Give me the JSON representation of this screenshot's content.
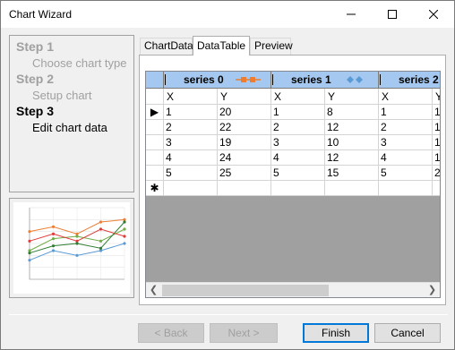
{
  "window": {
    "title": "Chart Wizard"
  },
  "steps": [
    {
      "title": "Step 1",
      "subtitle": "Choose chart type",
      "active": false
    },
    {
      "title": "Step 2",
      "subtitle": "Setup chart",
      "active": false
    },
    {
      "title": "Step 3",
      "subtitle": "Edit chart data",
      "active": true
    }
  ],
  "tabs": [
    {
      "label": "ChartData",
      "active": false
    },
    {
      "label": "DataTable",
      "active": true
    },
    {
      "label": "Preview",
      "active": false
    }
  ],
  "grid": {
    "series": [
      {
        "name": "series 0",
        "color": "#ed7d31"
      },
      {
        "name": "series 1",
        "color": "#5b9bd5"
      },
      {
        "name": "series 2",
        "color": ""
      }
    ],
    "col_headers": [
      "X",
      "Y",
      "X",
      "Y",
      "X",
      "Y"
    ],
    "rows": [
      [
        "1",
        "20",
        "1",
        "8",
        "1",
        "1"
      ],
      [
        "2",
        "22",
        "2",
        "12",
        "2",
        "1"
      ],
      [
        "3",
        "19",
        "3",
        "10",
        "3",
        "1"
      ],
      [
        "4",
        "24",
        "4",
        "12",
        "4",
        "1"
      ],
      [
        "5",
        "25",
        "5",
        "15",
        "5",
        "2"
      ]
    ],
    "current_row_marker": "▶",
    "new_row_marker": "✱"
  },
  "buttons": {
    "back": "< Back",
    "next": "Next >",
    "finish": "Finish",
    "cancel": "Cancel"
  },
  "colors": {
    "selection_header": "#a4c8ef",
    "accent": "#0078d7"
  },
  "preview_chart": {
    "type": "line",
    "x": [
      1,
      2,
      3,
      4,
      5
    ],
    "series": [
      {
        "color": "#ed7d31",
        "values": [
          20,
          22,
          19,
          24,
          25
        ]
      },
      {
        "color": "#5b9bd5",
        "values": [
          8,
          12,
          10,
          12,
          15
        ]
      },
      {
        "color": "#70ad47",
        "values": [
          12,
          17,
          18,
          16,
          21
        ]
      },
      {
        "color": "#e23b3b",
        "values": [
          16,
          19,
          16,
          21,
          18
        ]
      },
      {
        "color": "#2e7d32",
        "values": [
          11,
          14,
          15,
          13,
          24
        ]
      }
    ],
    "ylim": [
      0,
      30
    ],
    "xlim": [
      1,
      5
    ]
  }
}
